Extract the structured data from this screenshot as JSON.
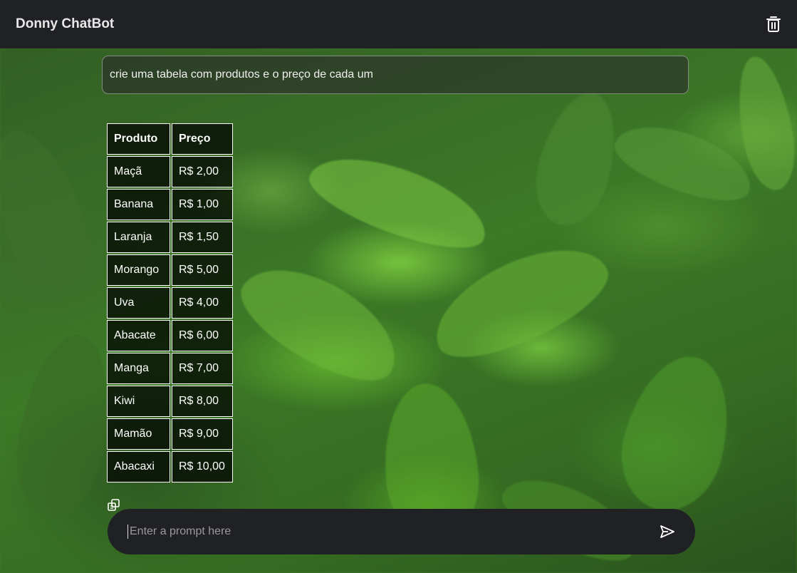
{
  "app": {
    "title": "Donny ChatBot"
  },
  "header": {
    "delete_icon": "trash-icon"
  },
  "chat": {
    "user_message": "crie uma tabela com produtos e o preço de cada um",
    "table": {
      "headers": [
        "Produto",
        "Preço"
      ],
      "rows": [
        [
          "Maçã",
          "R$ 2,00"
        ],
        [
          "Banana",
          "R$ 1,00"
        ],
        [
          "Laranja",
          "R$ 1,50"
        ],
        [
          "Morango",
          "R$ 5,00"
        ],
        [
          "Uva",
          "R$ 4,00"
        ],
        [
          "Abacate",
          "R$ 6,00"
        ],
        [
          "Manga",
          "R$ 7,00"
        ],
        [
          "Kiwi",
          "R$ 8,00"
        ],
        [
          "Mamão",
          "R$ 9,00"
        ],
        [
          "Abacaxi",
          "R$ 10,00"
        ]
      ]
    },
    "copy_icon": "copy-icon"
  },
  "input": {
    "placeholder": "Enter a prompt here",
    "value": "",
    "send_icon": "send-icon"
  }
}
